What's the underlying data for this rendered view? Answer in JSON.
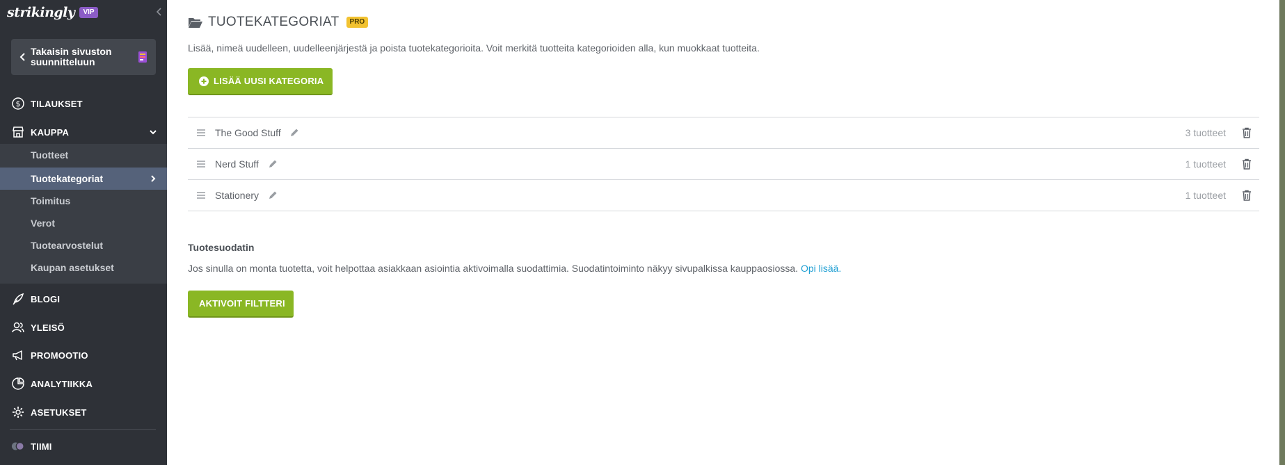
{
  "sidebar": {
    "brand": "strikingly",
    "vip_badge": "VIP",
    "back_label": "Takaisin sivuston suunnitteluun",
    "nav": [
      {
        "label": "TILAUKSET",
        "icon": "dollar-circle-icon"
      },
      {
        "label": "KAUPPA",
        "icon": "store-icon",
        "expanded": true
      },
      {
        "label": "BLOGI",
        "icon": "feather-icon"
      },
      {
        "label": "YLEISÖ",
        "icon": "users-icon"
      },
      {
        "label": "PROMOOTIO",
        "icon": "megaphone-icon"
      },
      {
        "label": "ANALYTIIKKA",
        "icon": "pie-chart-icon"
      },
      {
        "label": "ASETUKSET",
        "icon": "gear-icon"
      },
      {
        "label": "TIIMI",
        "icon": "team-avatars-icon"
      }
    ],
    "kauppa_submenu": [
      {
        "label": "Tuotteet"
      },
      {
        "label": "Tuotekategoriat",
        "active": true
      },
      {
        "label": "Toimitus"
      },
      {
        "label": "Verot"
      },
      {
        "label": "Tuotearvostelut"
      },
      {
        "label": "Kaupan asetukset"
      }
    ]
  },
  "main": {
    "title": "TUOTEKATEGORIAT",
    "pro_badge": "PRO",
    "description": "Lisää, nimeä uudelleen, uudelleenjärjestä ja poista tuotekategorioita. Voit merkitä tuotteita kategorioiden alla, kun muokkaat tuotteita.",
    "add_button": "LISÄÄ UUSI KATEGORIA",
    "categories": [
      {
        "name": "The Good Stuff",
        "count": "3 tuotteet"
      },
      {
        "name": "Nerd Stuff",
        "count": "1 tuotteet"
      },
      {
        "name": "Stationery",
        "count": "1 tuotteet"
      }
    ],
    "filter": {
      "title": "Tuotesuodatin",
      "description": "Jos sinulla on monta tuotetta, voit helpottaa asiakkaan asiointia aktivoimalla suodattimia. Suodatintoiminto näkyy sivupalkissa kauppaosiossa.",
      "link": "Opi lisää.",
      "button": "AKTIVOIT FILTTERI"
    }
  },
  "colors": {
    "sidebar_bg": "#2e3137",
    "submenu_bg": "#3a3e45",
    "active_bg": "#55627a",
    "accent_green": "#8ab724",
    "vip_purple": "#8b5cc6",
    "pro_yellow": "#f2c230",
    "link_blue": "#1f9fd3"
  }
}
